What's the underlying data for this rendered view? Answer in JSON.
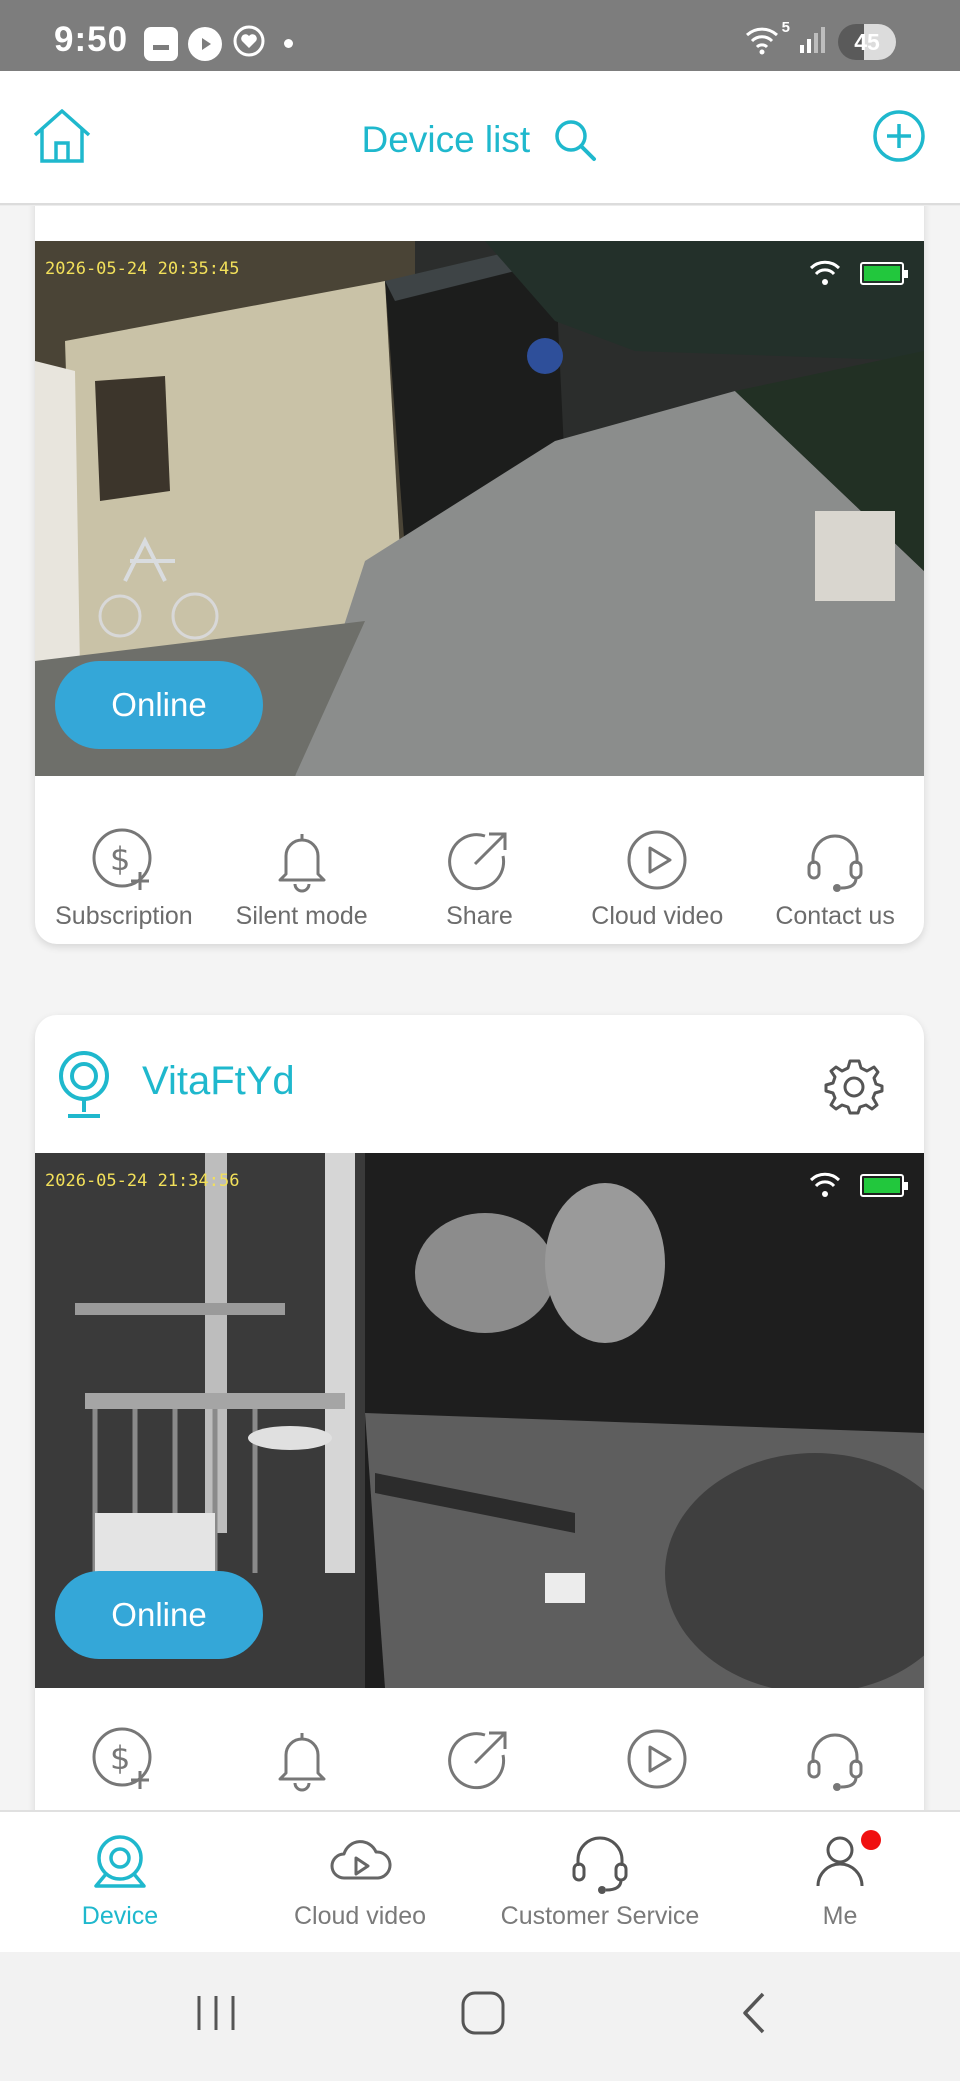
{
  "status_bar": {
    "time": "9:50",
    "network": "5",
    "battery": "45"
  },
  "header": {
    "title": "Device list",
    "home_icon": "home-icon",
    "search_icon": "search-icon",
    "add_icon": "plus-circle-icon"
  },
  "actions": [
    {
      "label": "Subscription",
      "icon": "subscription-dollar-icon"
    },
    {
      "label": "Silent mode",
      "icon": "bell-icon"
    },
    {
      "label": "Share",
      "icon": "share-icon"
    },
    {
      "label": "Cloud video",
      "icon": "play-circle-icon"
    },
    {
      "label": "Contact us",
      "icon": "headset-icon"
    }
  ],
  "cameras": [
    {
      "timestamp": "2026-05-24 20:35:45",
      "status": "Online"
    },
    {
      "name": "VitaFtYd",
      "timestamp": "2026-05-24 21:34:56",
      "status": "Online"
    }
  ],
  "bottom_nav": [
    {
      "label": "Device",
      "icon": "webcam-icon",
      "active": true
    },
    {
      "label": "Cloud video",
      "icon": "cloud-play-icon"
    },
    {
      "label": "Customer Service",
      "icon": "headset-icon"
    },
    {
      "label": "Me",
      "icon": "person-icon"
    }
  ],
  "colors": {
    "accent": "#1fb8cd",
    "online_pill": "#34a7d8",
    "status_bar": "#7d7d7d"
  }
}
